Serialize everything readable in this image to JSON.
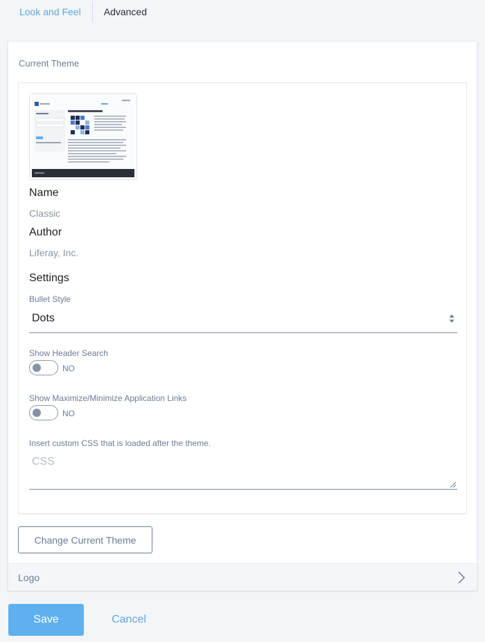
{
  "tabs": [
    {
      "label": "Look and Feel"
    },
    {
      "label": "Advanced"
    }
  ],
  "current_theme": {
    "section_title": "Current Theme",
    "name_label": "Name",
    "name_value": "Classic",
    "author_label": "Author",
    "author_value": "Liferay, Inc.",
    "settings_label": "Settings",
    "bullet_style": {
      "label": "Bullet Style",
      "selected": "Dots"
    },
    "header_search": {
      "label": "Show Header Search",
      "state": "NO"
    },
    "max_min_links": {
      "label": "Show Maximize/Minimize Application Links",
      "state": "NO"
    },
    "custom_css": {
      "label": "Insert custom CSS that is loaded after the theme.",
      "placeholder": "CSS"
    }
  },
  "change_theme_label": "Change Current Theme",
  "logo_label": "Logo",
  "actions": {
    "save": "Save",
    "cancel": "Cancel"
  },
  "colors": {
    "accent": "#5eb0ef",
    "link": "#5ea8e0",
    "muted": "#6b7c93"
  },
  "icons": [
    "sort-arrows-icon",
    "chevron-right-icon",
    "resize-grip-icon"
  ]
}
